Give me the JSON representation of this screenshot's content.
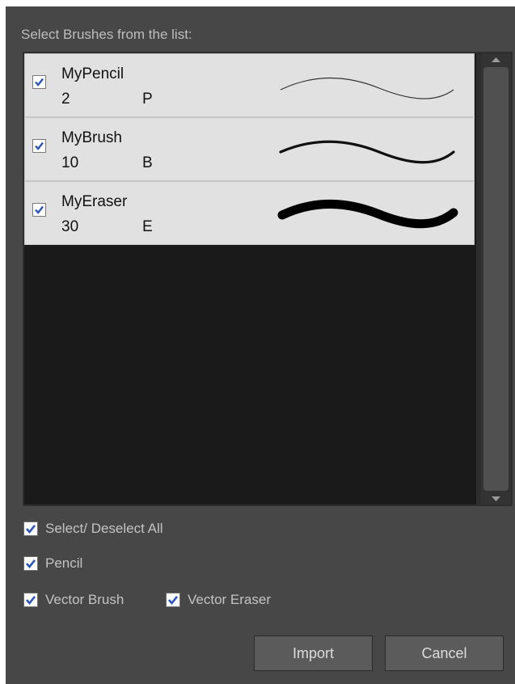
{
  "dialog": {
    "label": "Select Brushes from the list:"
  },
  "brushes": [
    {
      "name": "MyPencil",
      "size": "2",
      "key": "P",
      "stroke_icon": "thin-stroke-preview",
      "checked": true
    },
    {
      "name": "MyBrush",
      "size": "10",
      "key": "B",
      "stroke_icon": "medium-stroke-preview",
      "checked": true
    },
    {
      "name": "MyEraser",
      "size": "30",
      "key": "E",
      "stroke_icon": "thick-stroke-preview",
      "checked": true
    }
  ],
  "options": {
    "select_all": {
      "label": "Select/ Deselect All",
      "checked": true
    },
    "pencil": {
      "label": "Pencil",
      "checked": true
    },
    "vector_brush": {
      "label": "Vector Brush",
      "checked": true
    },
    "vector_eraser": {
      "label": "Vector Eraser",
      "checked": true
    }
  },
  "buttons": {
    "import": "Import",
    "cancel": "Cancel"
  },
  "colors": {
    "dialog_bg": "#474747",
    "list_bg": "#1a1a1a",
    "row_bg": "#e1e1e1",
    "check_mark": "#2b55b8",
    "button_bg": "#5b5b5b"
  }
}
